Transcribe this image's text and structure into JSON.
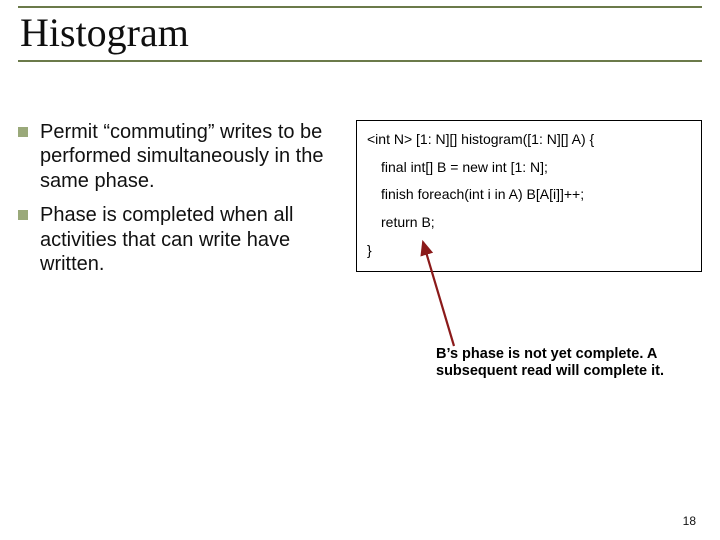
{
  "title": "Histogram",
  "bullets": [
    "Permit “commuting” writes to be performed simultaneously in the same phase.",
    "Phase is completed when all activities that can write have written."
  ],
  "code": {
    "line1": "<int N> [1: N][] histogram([1: N][] A) {",
    "line2": "final int[] B = new int [1: N];",
    "line3": "finish foreach(int i in A) B[A[i]]++;",
    "line4": "return B;",
    "line5": "}"
  },
  "caption": "B’s phase is not yet complete. A subsequent read will complete it.",
  "page_number": "18"
}
